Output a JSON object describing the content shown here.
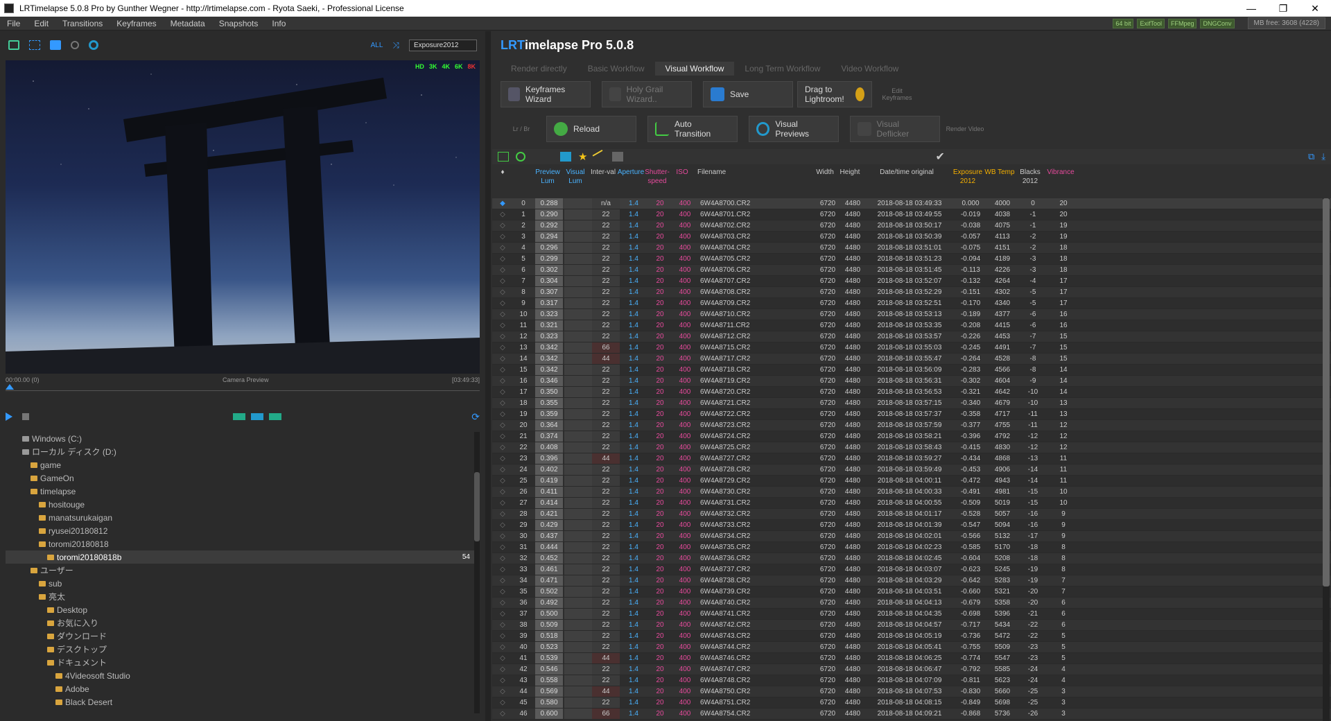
{
  "window": {
    "title": "LRTimelapse 5.0.8 Pro by Gunther Wegner - http://lrtimelapse.com - Ryota Saeki,  - Professional License",
    "controls": [
      "—",
      "❐",
      "✕"
    ]
  },
  "menu": [
    "File",
    "Edit",
    "Transitions",
    "Keyframes",
    "Metadata",
    "Snapshots",
    "Info"
  ],
  "status_tags": [
    "64 bit",
    "ExifTool",
    "FFMpeg",
    "DNGConv"
  ],
  "memory": "MB free: 3608 (4228)",
  "preview_toolbar": {
    "all": "ALL",
    "curve_select": "Exposure2012"
  },
  "preview": {
    "resolutions": [
      "HD",
      "3K",
      "4K",
      "6K",
      "8K"
    ],
    "res_colors": [
      "#3f3",
      "#3f3",
      "#3f3",
      "#3f3",
      "#e33"
    ],
    "time_left": "00:00.00 (0)",
    "label": "Camera Preview",
    "time_right": "[03:49:33]"
  },
  "tree": [
    {
      "label": "Windows (C:)",
      "indent": 2,
      "type": "drive"
    },
    {
      "label": "ローカル ディスク (D:)",
      "indent": 2,
      "type": "drive"
    },
    {
      "label": "game",
      "indent": 3
    },
    {
      "label": "GameOn",
      "indent": 3
    },
    {
      "label": "timelapse",
      "indent": 3
    },
    {
      "label": "hositouge",
      "indent": 4
    },
    {
      "label": "manatsurukaigan",
      "indent": 4
    },
    {
      "label": "ryusei20180812",
      "indent": 4
    },
    {
      "label": "toromi20180818",
      "indent": 4
    },
    {
      "label": "toromi20180818b",
      "indent": 5,
      "selected": true,
      "count": "54"
    },
    {
      "label": "ユーザー",
      "indent": 3
    },
    {
      "label": "sub",
      "indent": 4
    },
    {
      "label": "亮太",
      "indent": 4
    },
    {
      "label": "Desktop",
      "indent": 5
    },
    {
      "label": "お気に入り",
      "indent": 5
    },
    {
      "label": "ダウンロード",
      "indent": 5
    },
    {
      "label": "デスクトップ",
      "indent": 5
    },
    {
      "label": "ドキュメント",
      "indent": 5
    },
    {
      "label": "4Videosoft Studio",
      "indent": 6
    },
    {
      "label": "Adobe",
      "indent": 6
    },
    {
      "label": "Black Desert",
      "indent": 6
    }
  ],
  "app_title": {
    "prefix": "LRT",
    "rest": "imelapse Pro 5.0.8"
  },
  "workflow_tabs": [
    "Render directly",
    "Basic Workflow",
    "Visual Workflow",
    "Long Term Workflow",
    "Video Workflow"
  ],
  "workflow_row1": {
    "keyframes": "Keyframes Wizard",
    "holygrail": "Holy Grail Wizard..",
    "save": "Save",
    "drag": "Drag to Lightroom!",
    "edit": "Edit Keyframes"
  },
  "workflow_row2": {
    "lrbr": "Lr / Br",
    "reload": "Reload",
    "auto": "Auto Transition",
    "visual": "Visual Previews",
    "deflicker": "Visual Deflicker",
    "render": "Render Video"
  },
  "headers": [
    "",
    "",
    "Preview Lum",
    "Visual Lum",
    "Inter-val",
    "Aperture",
    "Shutter-speed",
    "ISO",
    "Filename",
    "Width",
    "Height",
    "Date/time original",
    "Exposure 2012",
    "WB Temp",
    "Blacks 2012",
    "Vibrance"
  ],
  "rows": [
    [
      "0",
      "0.288",
      "n/a",
      "6W4A8700.CR2",
      "2018-08-18 03:49:33",
      "0.000",
      "4000",
      "0",
      "20"
    ],
    [
      "1",
      "0.290",
      "22",
      "6W4A8701.CR2",
      "2018-08-18 03:49:55",
      "-0.019",
      "4038",
      "-1",
      "20"
    ],
    [
      "2",
      "0.292",
      "22",
      "6W4A8702.CR2",
      "2018-08-18 03:50:17",
      "-0.038",
      "4075",
      "-1",
      "19"
    ],
    [
      "3",
      "0.294",
      "22",
      "6W4A8703.CR2",
      "2018-08-18 03:50:39",
      "-0.057",
      "4113",
      "-2",
      "19"
    ],
    [
      "4",
      "0.296",
      "22",
      "6W4A8704.CR2",
      "2018-08-18 03:51:01",
      "-0.075",
      "4151",
      "-2",
      "18"
    ],
    [
      "5",
      "0.299",
      "22",
      "6W4A8705.CR2",
      "2018-08-18 03:51:23",
      "-0.094",
      "4189",
      "-3",
      "18"
    ],
    [
      "6",
      "0.302",
      "22",
      "6W4A8706.CR2",
      "2018-08-18 03:51:45",
      "-0.113",
      "4226",
      "-3",
      "18"
    ],
    [
      "7",
      "0.304",
      "22",
      "6W4A8707.CR2",
      "2018-08-18 03:52:07",
      "-0.132",
      "4264",
      "-4",
      "17"
    ],
    [
      "8",
      "0.307",
      "22",
      "6W4A8708.CR2",
      "2018-08-18 03:52:29",
      "-0.151",
      "4302",
      "-5",
      "17"
    ],
    [
      "9",
      "0.317",
      "22",
      "6W4A8709.CR2",
      "2018-08-18 03:52:51",
      "-0.170",
      "4340",
      "-5",
      "17"
    ],
    [
      "10",
      "0.323",
      "22",
      "6W4A8710.CR2",
      "2018-08-18 03:53:13",
      "-0.189",
      "4377",
      "-6",
      "16"
    ],
    [
      "11",
      "0.321",
      "22",
      "6W4A8711.CR2",
      "2018-08-18 03:53:35",
      "-0.208",
      "4415",
      "-6",
      "16"
    ],
    [
      "12",
      "0.323",
      "22",
      "6W4A8712.CR2",
      "2018-08-18 03:53:57",
      "-0.226",
      "4453",
      "-7",
      "15"
    ],
    [
      "13",
      "0.342",
      "66",
      "6W4A8715.CR2",
      "2018-08-18 03:55:03",
      "-0.245",
      "4491",
      "-7",
      "15"
    ],
    [
      "14",
      "0.342",
      "44",
      "6W4A8717.CR2",
      "2018-08-18 03:55:47",
      "-0.264",
      "4528",
      "-8",
      "15"
    ],
    [
      "15",
      "0.342",
      "22",
      "6W4A8718.CR2",
      "2018-08-18 03:56:09",
      "-0.283",
      "4566",
      "-8",
      "14"
    ],
    [
      "16",
      "0.346",
      "22",
      "6W4A8719.CR2",
      "2018-08-18 03:56:31",
      "-0.302",
      "4604",
      "-9",
      "14"
    ],
    [
      "17",
      "0.350",
      "22",
      "6W4A8720.CR2",
      "2018-08-18 03:56:53",
      "-0.321",
      "4642",
      "-10",
      "14"
    ],
    [
      "18",
      "0.355",
      "22",
      "6W4A8721.CR2",
      "2018-08-18 03:57:15",
      "-0.340",
      "4679",
      "-10",
      "13"
    ],
    [
      "19",
      "0.359",
      "22",
      "6W4A8722.CR2",
      "2018-08-18 03:57:37",
      "-0.358",
      "4717",
      "-11",
      "13"
    ],
    [
      "20",
      "0.364",
      "22",
      "6W4A8723.CR2",
      "2018-08-18 03:57:59",
      "-0.377",
      "4755",
      "-11",
      "12"
    ],
    [
      "21",
      "0.374",
      "22",
      "6W4A8724.CR2",
      "2018-08-18 03:58:21",
      "-0.396",
      "4792",
      "-12",
      "12"
    ],
    [
      "22",
      "0.408",
      "22",
      "6W4A8725.CR2",
      "2018-08-18 03:58:43",
      "-0.415",
      "4830",
      "-12",
      "12"
    ],
    [
      "23",
      "0.396",
      "44",
      "6W4A8727.CR2",
      "2018-08-18 03:59:27",
      "-0.434",
      "4868",
      "-13",
      "11"
    ],
    [
      "24",
      "0.402",
      "22",
      "6W4A8728.CR2",
      "2018-08-18 03:59:49",
      "-0.453",
      "4906",
      "-14",
      "11"
    ],
    [
      "25",
      "0.419",
      "22",
      "6W4A8729.CR2",
      "2018-08-18 04:00:11",
      "-0.472",
      "4943",
      "-14",
      "11"
    ],
    [
      "26",
      "0.411",
      "22",
      "6W4A8730.CR2",
      "2018-08-18 04:00:33",
      "-0.491",
      "4981",
      "-15",
      "10"
    ],
    [
      "27",
      "0.414",
      "22",
      "6W4A8731.CR2",
      "2018-08-18 04:00:55",
      "-0.509",
      "5019",
      "-15",
      "10"
    ],
    [
      "28",
      "0.421",
      "22",
      "6W4A8732.CR2",
      "2018-08-18 04:01:17",
      "-0.528",
      "5057",
      "-16",
      "9"
    ],
    [
      "29",
      "0.429",
      "22",
      "6W4A8733.CR2",
      "2018-08-18 04:01:39",
      "-0.547",
      "5094",
      "-16",
      "9"
    ],
    [
      "30",
      "0.437",
      "22",
      "6W4A8734.CR2",
      "2018-08-18 04:02:01",
      "-0.566",
      "5132",
      "-17",
      "9"
    ],
    [
      "31",
      "0.444",
      "22",
      "6W4A8735.CR2",
      "2018-08-18 04:02:23",
      "-0.585",
      "5170",
      "-18",
      "8"
    ],
    [
      "32",
      "0.452",
      "22",
      "6W4A8736.CR2",
      "2018-08-18 04:02:45",
      "-0.604",
      "5208",
      "-18",
      "8"
    ],
    [
      "33",
      "0.461",
      "22",
      "6W4A8737.CR2",
      "2018-08-18 04:03:07",
      "-0.623",
      "5245",
      "-19",
      "8"
    ],
    [
      "34",
      "0.471",
      "22",
      "6W4A8738.CR2",
      "2018-08-18 04:03:29",
      "-0.642",
      "5283",
      "-19",
      "7"
    ],
    [
      "35",
      "0.502",
      "22",
      "6W4A8739.CR2",
      "2018-08-18 04:03:51",
      "-0.660",
      "5321",
      "-20",
      "7"
    ],
    [
      "36",
      "0.492",
      "22",
      "6W4A8740.CR2",
      "2018-08-18 04:04:13",
      "-0.679",
      "5358",
      "-20",
      "6"
    ],
    [
      "37",
      "0.500",
      "22",
      "6W4A8741.CR2",
      "2018-08-18 04:04:35",
      "-0.698",
      "5396",
      "-21",
      "6"
    ],
    [
      "38",
      "0.509",
      "22",
      "6W4A8742.CR2",
      "2018-08-18 04:04:57",
      "-0.717",
      "5434",
      "-22",
      "6"
    ],
    [
      "39",
      "0.518",
      "22",
      "6W4A8743.CR2",
      "2018-08-18 04:05:19",
      "-0.736",
      "5472",
      "-22",
      "5"
    ],
    [
      "40",
      "0.523",
      "22",
      "6W4A8744.CR2",
      "2018-08-18 04:05:41",
      "-0.755",
      "5509",
      "-23",
      "5"
    ],
    [
      "41",
      "0.539",
      "44",
      "6W4A8746.CR2",
      "2018-08-18 04:06:25",
      "-0.774",
      "5547",
      "-23",
      "5"
    ],
    [
      "42",
      "0.546",
      "22",
      "6W4A8747.CR2",
      "2018-08-18 04:06:47",
      "-0.792",
      "5585",
      "-24",
      "4"
    ],
    [
      "43",
      "0.558",
      "22",
      "6W4A8748.CR2",
      "2018-08-18 04:07:09",
      "-0.811",
      "5623",
      "-24",
      "4"
    ],
    [
      "44",
      "0.569",
      "44",
      "6W4A8750.CR2",
      "2018-08-18 04:07:53",
      "-0.830",
      "5660",
      "-25",
      "3"
    ],
    [
      "45",
      "0.580",
      "22",
      "6W4A8751.CR2",
      "2018-08-18 04:08:15",
      "-0.849",
      "5698",
      "-25",
      "3"
    ],
    [
      "46",
      "0.600",
      "66",
      "6W4A8754.CR2",
      "2018-08-18 04:09:21",
      "-0.868",
      "5736",
      "-26",
      "3"
    ]
  ],
  "const": {
    "aperture": "1.4",
    "shutter": "20",
    "iso": "400",
    "width": "6720",
    "height": "4480"
  }
}
